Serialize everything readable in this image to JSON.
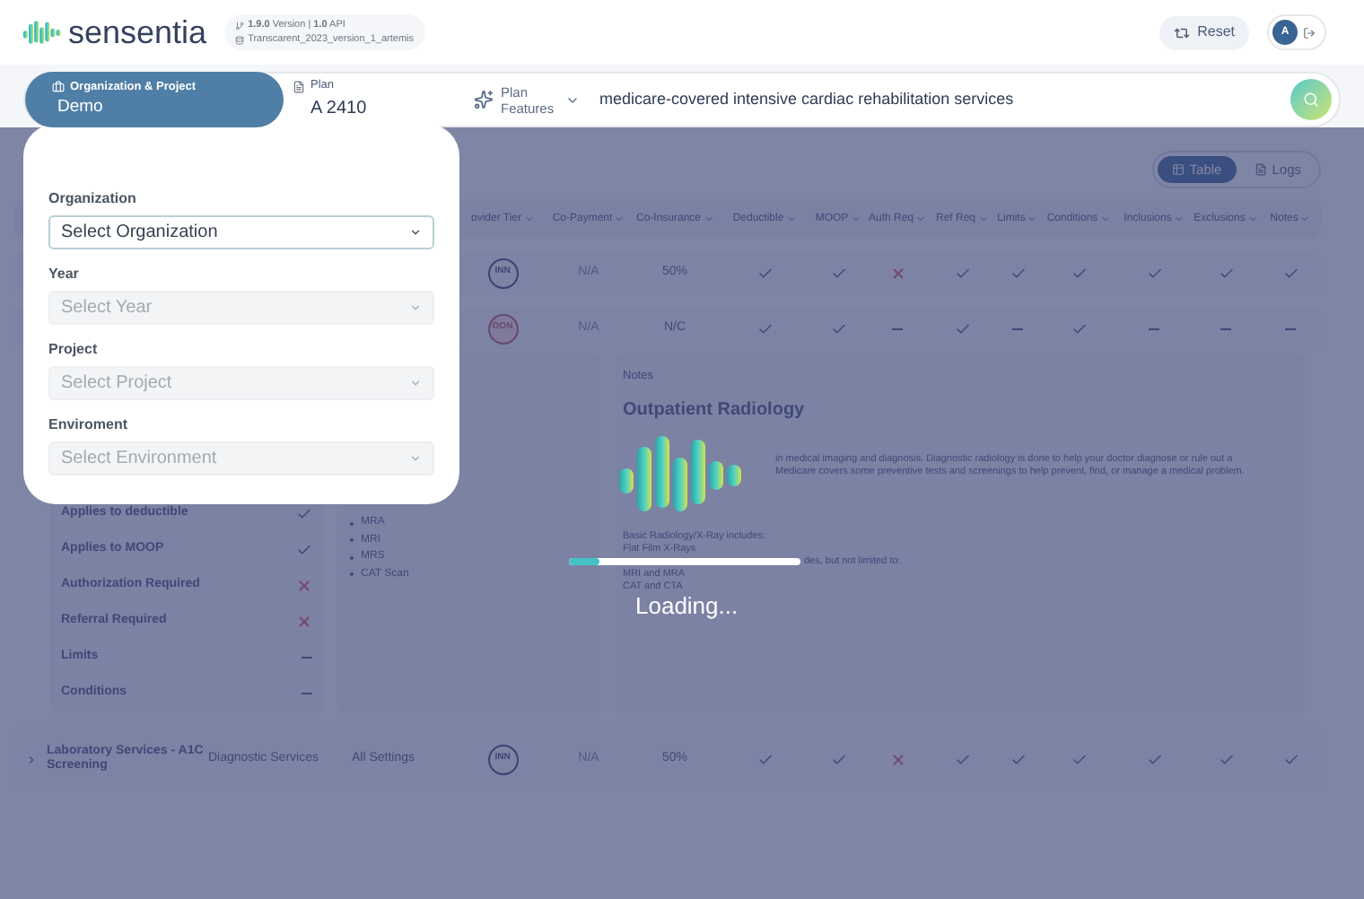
{
  "header": {
    "brand": "sensentia",
    "version": "**1.9.0** Version | **1.0** API",
    "branch": "Transcarent_2023_version_1_artemis",
    "reset": "Reset",
    "avatar": "A"
  },
  "search_bar": {
    "org_project": {
      "label": "Organization & Project",
      "value": "Demo"
    },
    "plan": {
      "label": "Plan",
      "value": "A 2410"
    },
    "plan_features": "Plan Features",
    "query": "medicare-covered intensive cardiac rehabilitation services"
  },
  "view_toggle": [
    {
      "label": "Table",
      "selected": true
    },
    {
      "label": "Logs",
      "selected": false
    }
  ],
  "table": {
    "columns": [
      "ovider Tier",
      "Co-Payment",
      "Co-Insurance",
      "Deductible",
      "MOOP",
      "Auth Req",
      "Ref Req",
      "Limits",
      "Conditions",
      "Inclusions",
      "Exclusions",
      "Notes"
    ],
    "rows": [
      {
        "tier": {
          "label": "INN",
          "kind": "in_network"
        },
        "copay": "N/A",
        "coinsurance": "50%",
        "marks": [
          {
            "kind": "check"
          },
          {
            "kind": "check"
          },
          {
            "kind": "cross"
          },
          {
            "kind": "check"
          },
          {
            "kind": "check"
          },
          {
            "kind": "check"
          },
          {
            "kind": "check"
          },
          {
            "kind": "check"
          },
          {
            "kind": "check"
          }
        ]
      },
      {
        "tier": {
          "label": "OON",
          "kind": "out_of_network"
        },
        "copay": "N/A",
        "coinsurance": "N/C",
        "marks": [
          {
            "kind": "check"
          },
          {
            "kind": "check"
          },
          {
            "kind": "dash"
          },
          {
            "kind": "check"
          },
          {
            "kind": "dash"
          },
          {
            "kind": "check"
          },
          {
            "kind": "dash"
          },
          {
            "kind": "dash"
          },
          {
            "kind": "dash"
          }
        ]
      },
      {
        "name": "Laboratory Services - A1C Screening",
        "category": "Diagnostic Services",
        "setting": "All Settings",
        "tier": {
          "label": "INN",
          "kind": "in_network"
        },
        "copay": "N/A",
        "coinsurance": "50%",
        "marks": [
          {
            "kind": "check"
          },
          {
            "kind": "check"
          },
          {
            "kind": "cross"
          },
          {
            "kind": "check"
          },
          {
            "kind": "check"
          },
          {
            "kind": "check"
          },
          {
            "kind": "check"
          },
          {
            "kind": "check"
          },
          {
            "kind": "check"
          }
        ]
      }
    ]
  },
  "details": {
    "benefits": [
      {
        "label": "Applies to deductible",
        "kind": "check"
      },
      {
        "label": "Applies to MOOP",
        "kind": "check"
      },
      {
        "label": "Authorization Required",
        "kind": "cross"
      },
      {
        "label": "Referral Required",
        "kind": "cross"
      },
      {
        "label": "Limits",
        "kind": "dash"
      },
      {
        "label": "Conditions",
        "kind": "dash"
      }
    ],
    "services": [
      "MRA",
      "MRI",
      "MRS",
      "CAT Scan"
    ],
    "notes": {
      "label": "Notes",
      "title": "Outpatient Radiology",
      "description": [
        "in medical imaging and diagnosis. Diagnostic radiology is done to help your doctor diagnose or rule out a",
        "Medicare covers some preventive tests and screenings to help prevent, find, or manage a medical problem."
      ],
      "lines": [
        "Basic Radiology/X-Ray includes:",
        "Flat Film X-Rays"
      ],
      "partial": "des, but not limited to:",
      "lines_after": [
        "MRI and MRA",
        "CAT and CTA"
      ]
    }
  },
  "modal": {
    "fields": [
      {
        "label": "Organization",
        "placeholder": "Select Organization",
        "disabled": false
      },
      {
        "label": "Year",
        "placeholder": "Select Year",
        "disabled": true
      },
      {
        "label": "Project",
        "placeholder": "Select Project",
        "disabled": true
      },
      {
        "label": "Enviroment",
        "placeholder": "Select Environment",
        "disabled": true
      }
    ]
  },
  "loader": {
    "text": "Loading...",
    "level": 0.13
  }
}
